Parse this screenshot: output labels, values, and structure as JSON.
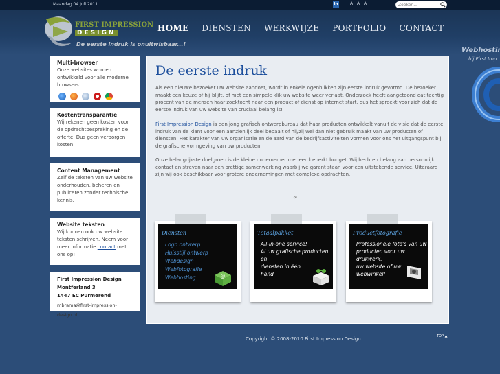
{
  "topbar": {
    "date": "Maandag 04 Juli 2011",
    "linkedin_label": "in",
    "font_size_controls": "A A A",
    "search_placeholder": "Zoeken..."
  },
  "logo": {
    "name_line1": "FIRST IMPRESSION",
    "name_line2": "DESIGN",
    "tagline": "De eerste indruk is onuitwisbaar...!"
  },
  "nav": {
    "items": [
      {
        "label": "HOME",
        "active": true
      },
      {
        "label": "DIENSTEN"
      },
      {
        "label": "WERKWIJZE"
      },
      {
        "label": "PORTFOLIO"
      },
      {
        "label": "CONTACT"
      }
    ]
  },
  "promo": {
    "title": "Webhosting",
    "subtitle": "bij First Imp"
  },
  "sidebar": {
    "boxes": [
      {
        "title": "Multi-browser",
        "text": "Onze websites worden ontwikkeld voor alle moderne browsers."
      },
      {
        "title": "Kostentransparantie",
        "text": "Wij rekenen geen kosten voor de opdrachtbespreking en de offerte. Dus geen verborgen kosten!"
      },
      {
        "title": "Content Management",
        "text": "Zelf de teksten van uw website onderhouden, beheren en publiceren zonder technische kennis."
      },
      {
        "title": "Website teksten",
        "text_before": "Wij kunnen ook uw website teksten schrijven. Neem voor meer informatie ",
        "link": "contact",
        "text_after": " met ons op!"
      }
    ],
    "contact": {
      "company": "First Impression Design",
      "street": "Montferland 3",
      "city": "1447 EC Purmerend",
      "email": "mbrama@first-impression-design.nl"
    }
  },
  "main": {
    "heading": "De eerste indruk",
    "p1": "Als een nieuwe bezoeker uw website aandoet, wordt in enkele ogenblikken zijn eerste indruk gevormd. De bezoeker maakt een keuze of hij blijft, of met een simpele klik uw website weer verlaat. Onderzoek heeft aangetoond dat tachtig procent van de mensen haar zoektocht naar een product of dienst op internet start, dus het spreekt voor zich dat de eerste indruk van uw website van cruciaal belang is!",
    "p2_link": "First Impression Design",
    "p2": " is een jong grafisch ontwerpbureau dat haar producten ontwikkelt vanuit de visie dat de eerste indruk van de klant voor een aanzienlijk deel bepaalt of hij/zij wel dan niet gebruik maakt van uw producten of diensten. Het karakter van uw organisatie en de aard van de bedrijfsactiviteiten vormen voor ons het uitgangspunt bij de grafische vormgeving van uw producten.",
    "p3": "Onze belangrijkste doelgroep is de kleine ondernemer met een beperkt budget. Wij hechten belang aan persoonlijk contact en streven naar een prettige samenwerking waarbij we garant staan voor een uitstekende service. Uiteraard zijn wij ook beschikbaar voor grotere ondernemingen met complexe opdrachten.",
    "divider_glyph": "∞"
  },
  "cards": [
    {
      "title": "Diensten",
      "items": [
        "Logo ontwerp",
        "Huisstijl ontwerp",
        "Webdesign",
        "Webfotografie",
        "Webhosting"
      ]
    },
    {
      "title": "Totaalpakket",
      "items": [
        "All-in-one service!",
        "Al uw grafische producten en",
        "diensten in één hand"
      ]
    },
    {
      "title": "Productfotografie",
      "items": [
        "Professionele foto's van uw",
        "producten voor uw drukwerk,",
        "uw website of uw webwinkel!"
      ]
    }
  ],
  "footer": {
    "copyright": "Copyright © 2008-2010 First Impression Design",
    "top_link": "TOP ▲"
  },
  "colors": {
    "background": "#2c4d78",
    "header_dark": "#0b1c33",
    "link_blue": "#1d4f9c",
    "logo_green": "#8aa23a"
  }
}
